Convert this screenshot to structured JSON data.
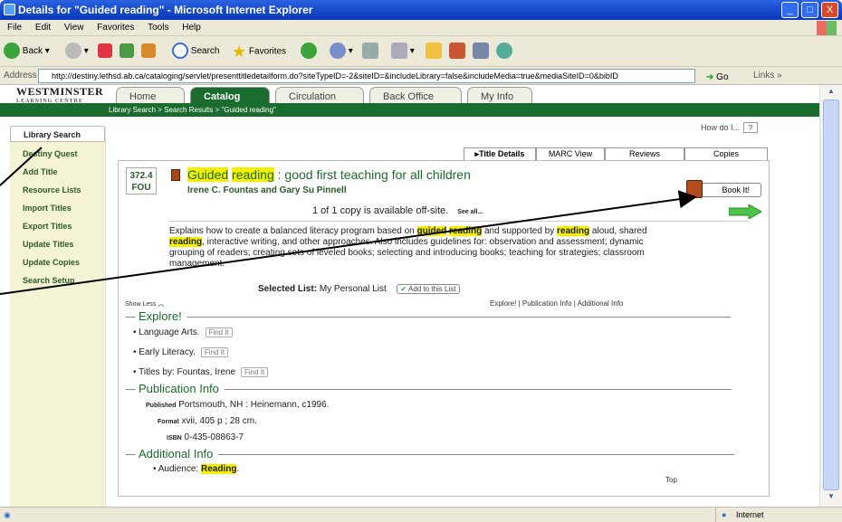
{
  "window": {
    "title": "Details for \"Guided reading\" - Microsoft Internet Explorer",
    "minimize": "_",
    "maximize": "□",
    "close": "X"
  },
  "menu": [
    "File",
    "Edit",
    "View",
    "Favorites",
    "Tools",
    "Help"
  ],
  "toolbar": {
    "back": "Back",
    "search": "Search",
    "favorites": "Favorites"
  },
  "address": {
    "label": "Address",
    "url": "http://destiny.lethsd.ab.ca/cataloging/servlet/presenttitledetailform.do?siteTypeID=-2&siteID=&includeLibrary=false&includeMedia=true&mediaSiteID=0&bibID",
    "go": "Go",
    "links": "Links »"
  },
  "logo": {
    "main": "WESTMINSTER",
    "sub": "LEARNING CENTRE"
  },
  "nav_tabs": [
    "Home",
    "Catalog",
    "Circulation",
    "Back Office",
    "My Info"
  ],
  "breadcrumb": "Library Search > Search Results > \"Guided reading\"",
  "sidebar": {
    "header": "Library Search",
    "items": [
      "Destiny Quest",
      "Add Title",
      "Resource Lists",
      "Import Titles",
      "Export Titles",
      "Update Titles",
      "Update Copies",
      "Search Setup"
    ]
  },
  "howdo": {
    "label": "How do I...",
    "q": "?"
  },
  "detail_tabs": [
    "Title Details",
    "MARC View",
    "Reviews",
    "Copies"
  ],
  "record": {
    "call_number": "372.4",
    "call_suffix": "FOU",
    "title_part1": "Guided",
    "title_part2": "reading",
    "title_rest": " : good first teaching for all children",
    "authors": "Irene C. Fountas and Gary Su Pinnell",
    "availability": "1 of 1 copy is available off-site.",
    "see_all": "See all...",
    "bookit": "Book It!",
    "description": {
      "s1": "Explains how to create a balanced literacy program based on ",
      "h1": "guided",
      "s2": " ",
      "h2": "reading",
      "s3": " and supported by ",
      "h3": "reading",
      "s4": " aloud, shared ",
      "h4": "reading",
      "s5": ", interactive writing, and other approaches. Also includes guidelines for: observation and assessment; dynamic grouping of readers; creating sets of leveled books; selecting and introducing books; teaching for strategies; classroom management."
    },
    "selected_list_label": "Selected List:",
    "selected_list_value": "My Personal List",
    "add_to_list": "Add to this List",
    "show_less": "Show Less",
    "right_links": "Explore! | Publication Info | Additional Info"
  },
  "explore": {
    "heading": "Explore!",
    "items": [
      "Language Arts.",
      "Early Literacy.",
      "Titles by: Fountas, Irene"
    ],
    "find_it": "Find It"
  },
  "publication": {
    "heading": "Publication Info",
    "published_label": "Published",
    "published": "Portsmouth, NH : Heinemann, c1996.",
    "format_label": "Format",
    "format": "xvii, 405 p ; 28 cm.",
    "isbn_label": "ISBN",
    "isbn": "0-435-08863-7"
  },
  "additional": {
    "heading": "Additional Info",
    "audience_label": "Audience:",
    "audience": "Reading",
    "audience_end": "."
  },
  "top_link": "Top",
  "status": {
    "zone": "Internet"
  }
}
